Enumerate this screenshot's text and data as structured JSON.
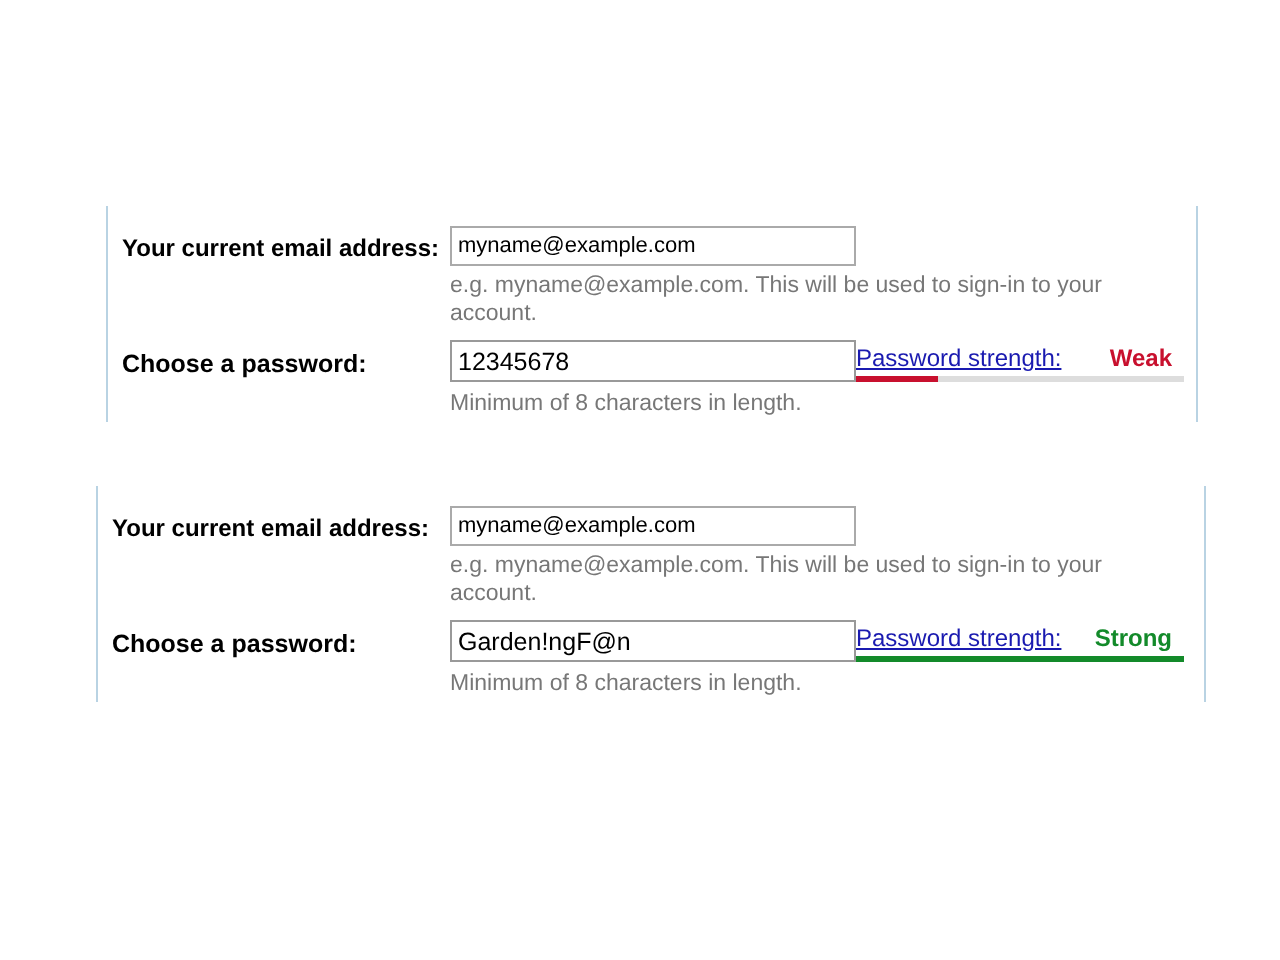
{
  "forms": [
    {
      "email": {
        "label": "Your current email address:",
        "value": "myname@example.com",
        "hint": "e.g. myname@example.com. This will be used to sign-in to your account."
      },
      "password": {
        "label": "Choose a password:",
        "value": "12345678",
        "hint": "Minimum of 8 characters in length.",
        "strength_link": "Password strength:",
        "strength": "Weak",
        "color": "#c8102e",
        "level": 0.25
      }
    },
    {
      "email": {
        "label": "Your current email address:",
        "value": "myname@example.com",
        "hint": "e.g. myname@example.com. This will be used to sign-in to your account."
      },
      "password": {
        "label": "Choose a password:",
        "value": "Garden!ngF@n",
        "hint": "Minimum of 8 characters in length.",
        "strength_link": "Password strength:",
        "strength": "Strong",
        "color": "#138a2a",
        "level": 1
      }
    }
  ]
}
